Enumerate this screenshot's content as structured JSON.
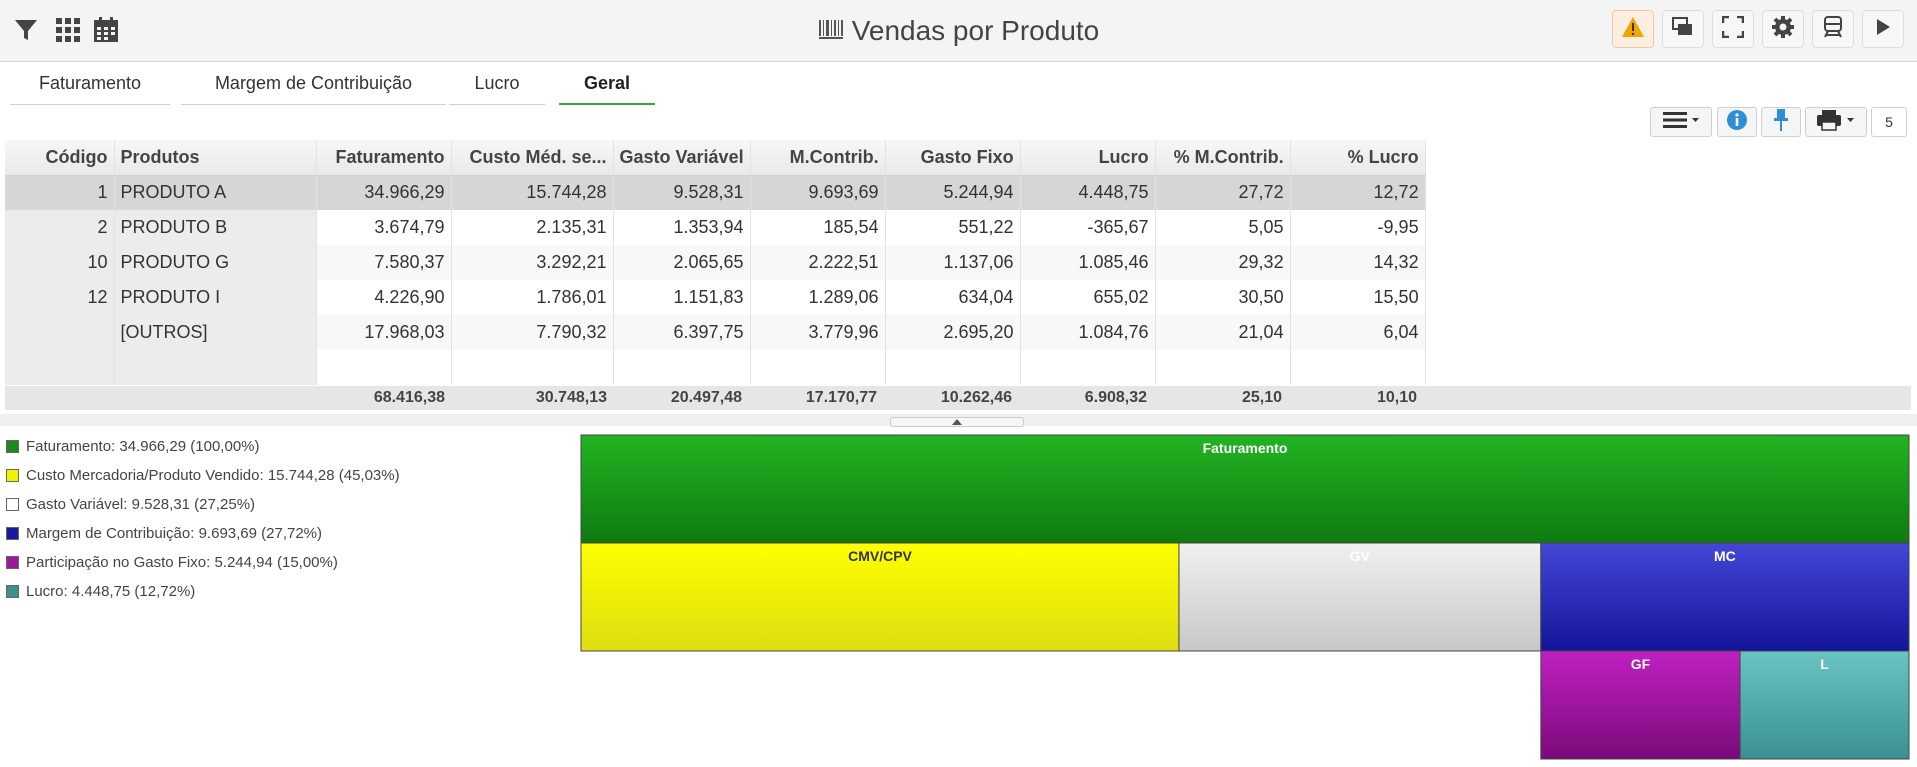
{
  "header": {
    "title": "Vendas por Produto",
    "left_icons": [
      "filter-icon",
      "grid-icon",
      "calendar-icon"
    ],
    "right_buttons": [
      "warning-icon",
      "windows-icon",
      "fullscreen-icon",
      "gear-icon",
      "train-icon",
      "play-icon"
    ]
  },
  "tabs": [
    {
      "label": "Faturamento",
      "active": false
    },
    {
      "label": "Margem de Contribuição",
      "active": false
    },
    {
      "label": "Lucro",
      "active": false
    },
    {
      "label": "Geral",
      "active": true
    }
  ],
  "toolbar": {
    "counter": "5",
    "icons": [
      "menu-icon",
      "info-icon",
      "pin-icon",
      "print-icon"
    ]
  },
  "table": {
    "columns": [
      "Código",
      "Produtos",
      "Faturamento",
      "Custo Méd. se...",
      "Gasto Variável",
      "M.Contrib.",
      "Gasto Fixo",
      "Lucro",
      "% M.Contrib.",
      "% Lucro"
    ],
    "rows": [
      [
        "1",
        "PRODUTO A",
        "34.966,29",
        "15.744,28",
        "9.528,31",
        "9.693,69",
        "5.244,94",
        "4.448,75",
        "27,72",
        "12,72"
      ],
      [
        "2",
        "PRODUTO B",
        "3.674,79",
        "2.135,31",
        "1.353,94",
        "185,54",
        "551,22",
        "-365,67",
        "5,05",
        "-9,95"
      ],
      [
        "10",
        "PRODUTO G",
        "7.580,37",
        "3.292,21",
        "2.065,65",
        "2.222,51",
        "1.137,06",
        "1.085,46",
        "29,32",
        "14,32"
      ],
      [
        "12",
        "PRODUTO I",
        "4.226,90",
        "1.786,01",
        "1.151,83",
        "1.289,06",
        "634,04",
        "655,02",
        "30,50",
        "15,50"
      ],
      [
        "",
        "[OUTROS]",
        "17.968,03",
        "7.790,32",
        "6.397,75",
        "3.779,96",
        "2.695,20",
        "1.084,76",
        "21,04",
        "6,04"
      ]
    ],
    "totals": [
      "68.416,38",
      "30.748,13",
      "20.497,48",
      "17.170,77",
      "10.262,46",
      "6.908,32",
      "25,10",
      "10,10"
    ]
  },
  "legend": [
    {
      "label": "Faturamento:",
      "value": "34.966,29 (100,00%)",
      "color": "#1a8a1a"
    },
    {
      "label": "Custo Mercadoria/Produto Vendido:",
      "value": "15.744,28 (45,03%)",
      "color": "#f2f200"
    },
    {
      "label": "Gasto Variável:",
      "value": "9.528,31 (27,25%)",
      "color": "#ffffff"
    },
    {
      "label": "Margem de Contribuição:",
      "value": "9.693,69 (27,72%)",
      "color": "#1a1aa0"
    },
    {
      "label": "Participação no Gasto Fixo:",
      "value": "5.244,94 (15,00%)",
      "color": "#9a1a9a"
    },
    {
      "label": "Lucro:",
      "value": "4.448,75 (12,72%)",
      "color": "#3a9090"
    }
  ],
  "chart_data": {
    "type": "treemap",
    "nodes": [
      {
        "label": "Faturamento",
        "value": 34966.29,
        "color": "#1fa81f"
      },
      {
        "label": "CMV/CPV",
        "value": 15744.28,
        "color": "#f2f200"
      },
      {
        "label": "GV",
        "value": 9528.31,
        "color": "#dedede"
      },
      {
        "label": "MC",
        "value": 9693.69,
        "color": "#2a2ab8"
      },
      {
        "label": "GF",
        "value": 5244.94,
        "color": "#a01aa0"
      },
      {
        "label": "L",
        "value": 4448.75,
        "color": "#50a8a8"
      }
    ]
  }
}
